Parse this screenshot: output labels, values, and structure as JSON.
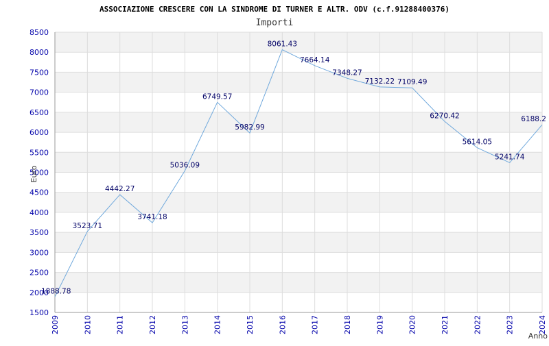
{
  "chart_data": {
    "type": "line",
    "title": "ASSOCIAZIONE CRESCERE CON LA SINDROME DI TURNER E ALTR. ODV (c.f.91288400376)",
    "subtitle": "Importi",
    "xlabel": "Anno",
    "ylabel": "Euro",
    "x": [
      "2009",
      "2010",
      "2011",
      "2012",
      "2013",
      "2014",
      "2015",
      "2016",
      "2017",
      "2018",
      "2019",
      "2020",
      "2021",
      "2022",
      "2023",
      "2024"
    ],
    "values": [
      1888.78,
      3523.71,
      4442.27,
      3741.18,
      5036.09,
      6749.57,
      5982.99,
      8061.43,
      7664.14,
      7348.27,
      7132.22,
      7109.49,
      6270.42,
      5614.05,
      5241.74,
      6188.2
    ],
    "labels": [
      "1888.78",
      "3523.71",
      "4442.27",
      "3741.18",
      "5036.09",
      "6749.57",
      "5982.99",
      "8061.43",
      "7664.14",
      "7348.27",
      "7132.22",
      "7109.49",
      "6270.42",
      "5614.05",
      "5241.74",
      "6188.2"
    ],
    "ylim": [
      1500,
      8500
    ],
    "yticks": [
      1500,
      2000,
      2500,
      3000,
      3500,
      4000,
      4500,
      5000,
      5500,
      6000,
      6500,
      7000,
      7500,
      8000,
      8500
    ],
    "grid": true,
    "colors": {
      "line": "#6fa8dc",
      "band": "#f2f2f2",
      "grid": "#dddddd",
      "tick": "#0000aa",
      "label": "#000066"
    }
  }
}
